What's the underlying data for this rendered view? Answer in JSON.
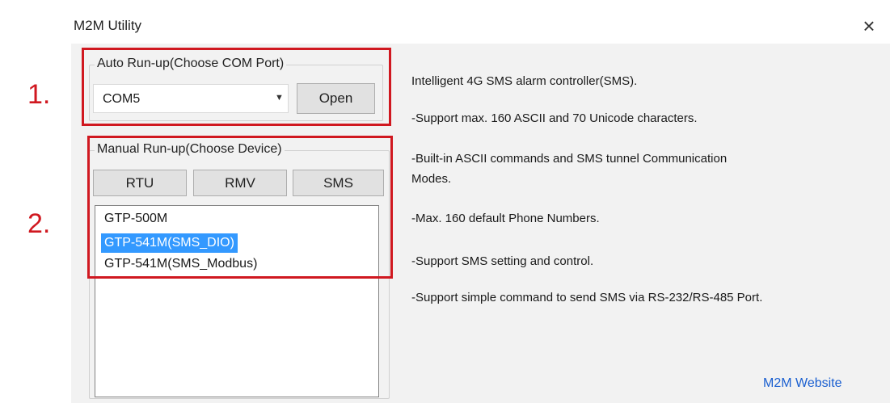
{
  "window": {
    "title": "M2M Utility",
    "close_glyph": "×"
  },
  "annotations": {
    "step1": "1.",
    "step2": "2."
  },
  "auto_run": {
    "legend": "Auto Run-up(Choose COM Port)",
    "com_port": "COM5",
    "dropdown_glyph": "▼",
    "open_label": "Open"
  },
  "manual_run": {
    "legend": "Manual Run-up(Choose Device)",
    "buttons": [
      "RTU",
      "RMV",
      "SMS"
    ],
    "devices": [
      "GTP-500M",
      "GTP-541M(SMS_DIO)",
      "GTP-541M(SMS_Modbus)"
    ],
    "selected_device": "GTP-541M(SMS_DIO)"
  },
  "description": {
    "lines": [
      "Intelligent 4G SMS alarm controller(SMS).",
      "-Support max. 160 ASCII and 70 Unicode characters.",
      "-Built-in ASCII commands and SMS tunnel Communication",
      "Modes.",
      "-Max. 160 default Phone Numbers.",
      "-Support SMS setting and control.",
      "-Support simple command to send SMS via RS-232/RS-485 Port."
    ]
  },
  "footer": {
    "website_link": "M2M Website"
  },
  "colors": {
    "annotation_red": "#d01820",
    "selection_blue": "#3399ff",
    "link_blue": "#1a5fd0",
    "window_bg": "#f2f2f2"
  }
}
